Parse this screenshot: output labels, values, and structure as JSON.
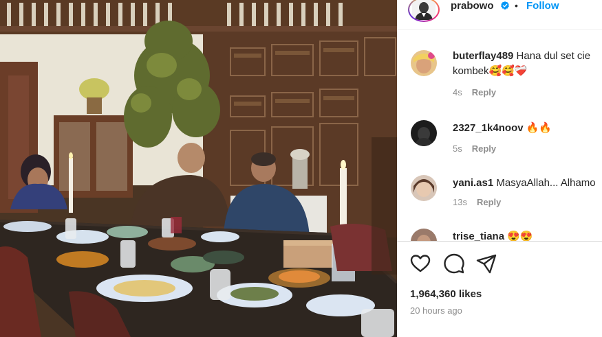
{
  "post": {
    "author": "prabowo",
    "follow_label": "Follow",
    "separator": "•",
    "likes": "1,964,360 likes",
    "time_ago": "20 hours ago"
  },
  "comments": [
    {
      "user": "buterflay489",
      "text": "Hana dul set cie",
      "text2": "kombek🥰🥰❤️‍🩹",
      "time": "4s",
      "reply": "Reply"
    },
    {
      "user": "2327_1k4noov",
      "text": "🔥🔥",
      "time": "5s",
      "reply": "Reply"
    },
    {
      "user": "yani.as1",
      "text": "MasyaAllah... Alhamo",
      "time": "13s",
      "reply": "Reply"
    },
    {
      "user": "trise_tiana",
      "text": "😍😍",
      "time": "",
      "reply": ""
    }
  ],
  "icons": {
    "verified": "verified-badge-icon",
    "like": "heart-icon",
    "comment": "comment-bubble-icon",
    "share": "paper-plane-icon"
  },
  "colors": {
    "link_blue": "#0095f6",
    "text_primary": "#262626",
    "text_secondary": "#8e8e8e"
  }
}
